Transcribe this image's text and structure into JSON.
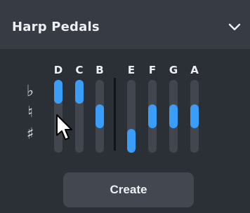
{
  "header": {
    "title": "Harp Pedals",
    "collapse_icon": "chevron-down-icon"
  },
  "accidentals": {
    "flat": "♭",
    "natural": "♮",
    "sharp": "♯"
  },
  "pedals": [
    {
      "note": "D",
      "position": "flat"
    },
    {
      "note": "C",
      "position": "flat"
    },
    {
      "note": "B",
      "position": "natural"
    },
    {
      "note": "E",
      "position": "sharp"
    },
    {
      "note": "F",
      "position": "natural"
    },
    {
      "note": "G",
      "position": "natural"
    },
    {
      "note": "A",
      "position": "natural"
    }
  ],
  "create_button": {
    "label": "Create"
  },
  "colors": {
    "accent": "#3a9df8",
    "header_bg": "#373b43",
    "panel_bg": "#2b2f36"
  },
  "cursor_icon": "mouse-pointer-icon"
}
